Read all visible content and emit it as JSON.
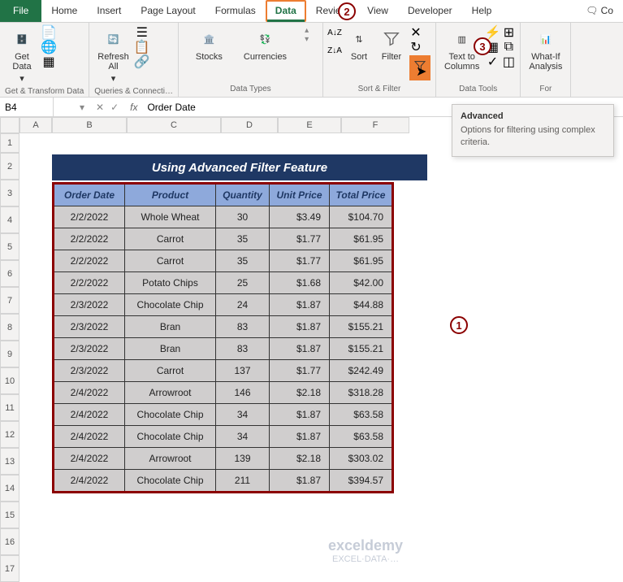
{
  "tabs": [
    "File",
    "Home",
    "Insert",
    "Page Layout",
    "Formulas",
    "Data",
    "Review",
    "View",
    "Developer",
    "Help"
  ],
  "active_tab_index": 5,
  "ribbon_groups": {
    "get_transform": {
      "label": "Get & Transform Data",
      "get_data": "Get\nData"
    },
    "queries": {
      "label": "Queries & Connecti…",
      "refresh": "Refresh\nAll"
    },
    "data_types": {
      "label": "Data Types",
      "stocks": "Stocks",
      "currencies": "Currencies"
    },
    "sort_filter": {
      "label": "Sort & Filter",
      "sort": "Sort",
      "filter": "Filter"
    },
    "data_tools": {
      "label": "Data Tools",
      "text_to_cols": "Text to\nColumns"
    },
    "forecast": {
      "label": "For",
      "whatif": "What-If\nAnalysis"
    }
  },
  "tooltip": {
    "title": "Advanced",
    "body": "Options for filtering using complex criteria."
  },
  "name_box": "B4",
  "formula_value": "Order Date",
  "sheet_title": "Using Advanced Filter Feature",
  "columns": [
    "A",
    "B",
    "C",
    "D",
    "E",
    "F"
  ],
  "row_numbers": [
    "1",
    "2",
    "3",
    "4",
    "5",
    "6",
    "7",
    "8",
    "9",
    "10",
    "11",
    "12",
    "13",
    "14",
    "15",
    "16",
    "17"
  ],
  "chart_data": {
    "type": "table",
    "headers": [
      "Order Date",
      "Product",
      "Quantity",
      "Unit Price",
      "Total Price"
    ],
    "rows": [
      [
        "2/2/2022",
        "Whole Wheat",
        "30",
        "$3.49",
        "$104.70"
      ],
      [
        "2/2/2022",
        "Carrot",
        "35",
        "$1.77",
        "$61.95"
      ],
      [
        "2/2/2022",
        "Carrot",
        "35",
        "$1.77",
        "$61.95"
      ],
      [
        "2/2/2022",
        "Potato Chips",
        "25",
        "$1.68",
        "$42.00"
      ],
      [
        "2/3/2022",
        "Chocolate Chip",
        "24",
        "$1.87",
        "$44.88"
      ],
      [
        "2/3/2022",
        "Bran",
        "83",
        "$1.87",
        "$155.21"
      ],
      [
        "2/3/2022",
        "Bran",
        "83",
        "$1.87",
        "$155.21"
      ],
      [
        "2/3/2022",
        "Carrot",
        "137",
        "$1.77",
        "$242.49"
      ],
      [
        "2/4/2022",
        "Arrowroot",
        "146",
        "$2.18",
        "$318.28"
      ],
      [
        "2/4/2022",
        "Chocolate Chip",
        "34",
        "$1.87",
        "$63.58"
      ],
      [
        "2/4/2022",
        "Chocolate Chip",
        "34",
        "$1.87",
        "$63.58"
      ],
      [
        "2/4/2022",
        "Arrowroot",
        "139",
        "$2.18",
        "$303.02"
      ],
      [
        "2/4/2022",
        "Chocolate Chip",
        "211",
        "$1.87",
        "$394.57"
      ]
    ]
  },
  "callouts": {
    "c1": "1",
    "c2": "2",
    "c3": "3"
  },
  "watermark": {
    "brand": "exceldemy",
    "tag": "EXCEL·DATA·…"
  },
  "right_button": "Co"
}
